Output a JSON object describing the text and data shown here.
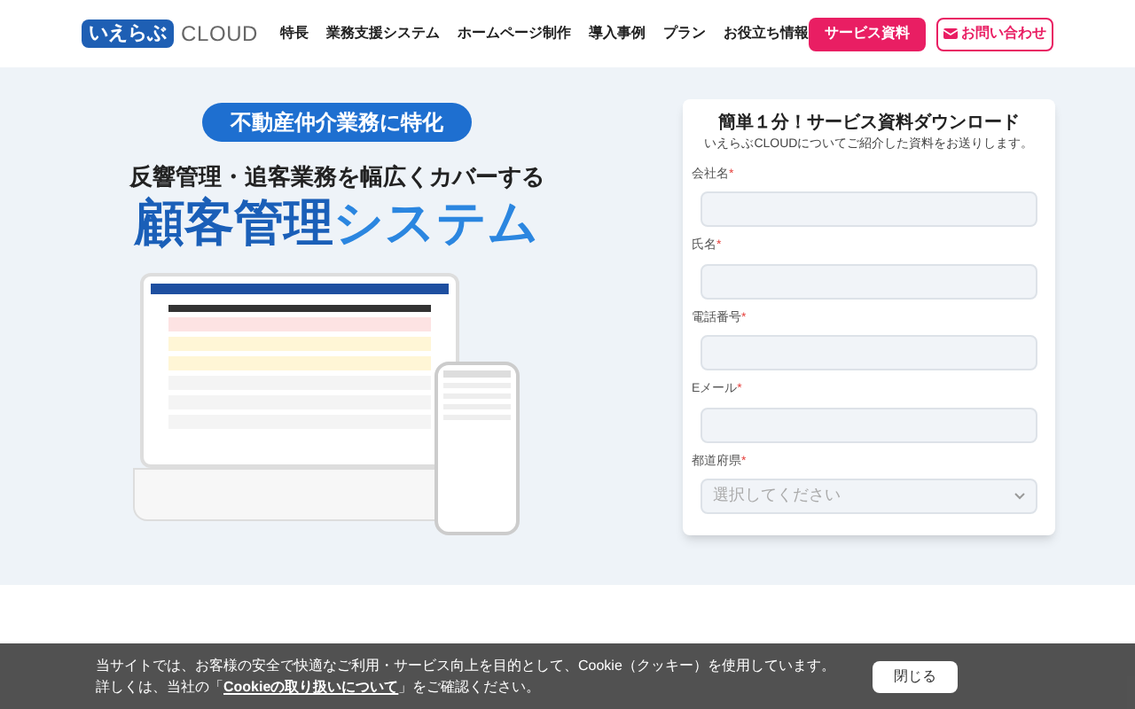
{
  "header": {
    "logo_mark": "いえらぶ",
    "logo_text": "CLOUD",
    "nav": [
      "特長",
      "業務支援システム",
      "ホームページ制作",
      "導入事例",
      "プラン",
      "お役立ち情報"
    ],
    "buttons": [
      {
        "kind": "primary",
        "label": "サービス資料"
      },
      {
        "kind": "outline",
        "label": "お問い合わせ"
      }
    ]
  },
  "hero": {
    "badge": "不動産仲介業務に特化",
    "subtitle": "反響管理・追客業務を幅広くカバーする",
    "title_kanji": "顧客管理",
    "title_kana": "システム"
  },
  "form": {
    "title": "簡単１分！サービス資料ダウンロード",
    "subtitle": "いえらぶCLOUDについてご紹介した資料をお送りします。",
    "fields": [
      {
        "kind": "text",
        "label": "会社名",
        "required_mark": "*"
      },
      {
        "kind": "text",
        "label": "氏名",
        "required_mark": "*"
      },
      {
        "kind": "text",
        "label": "電話番号",
        "required_mark": "*"
      },
      {
        "kind": "text",
        "label": "Eメール",
        "required_mark": "*"
      },
      {
        "kind": "select",
        "label": "都道府県",
        "required_mark": "*",
        "placeholder": "選択してください"
      }
    ]
  },
  "cookie_bar": {
    "line_1": "当サイトでは、お客様の安全で快適なご利用・サービス向上を目的として、Cookie（クッキー）を使用しています。",
    "line_2_before": "詳しくは、当社の「",
    "link": "Cookieの取り扱いについて",
    "line_2_after": "」をご確認ください。",
    "button": "閉じる"
  }
}
